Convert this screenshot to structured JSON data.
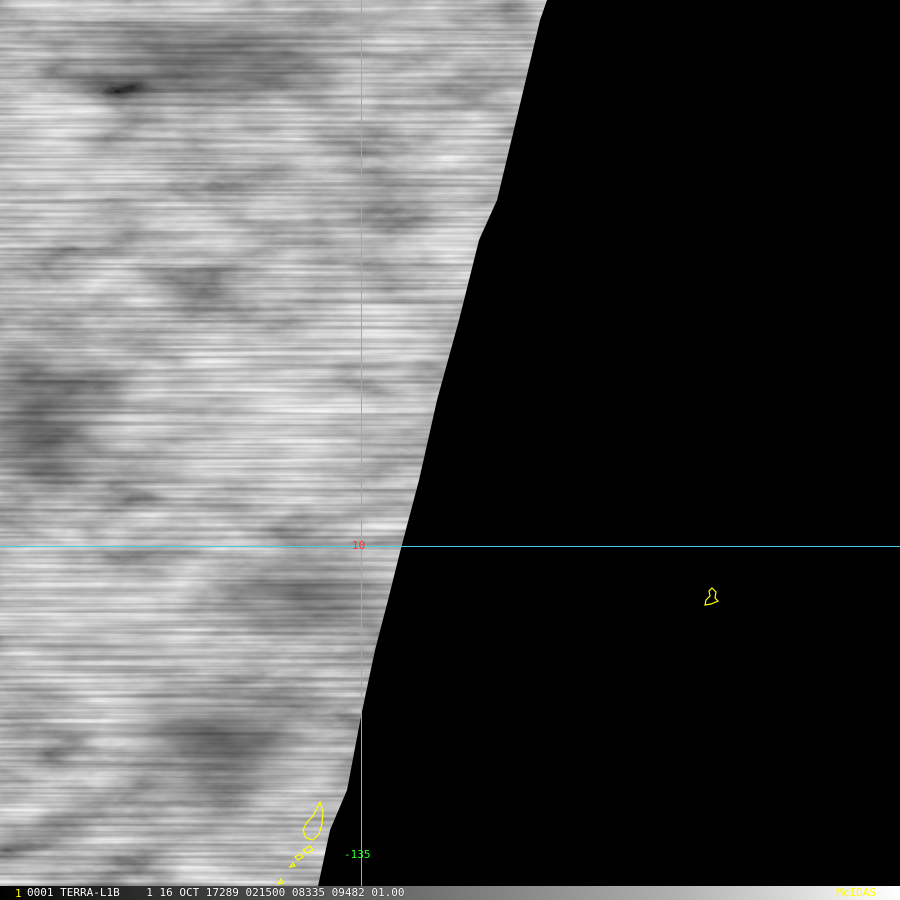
{
  "map": {
    "lat_label": "10",
    "lon_label": "-135",
    "colors": {
      "graticule": "#40d0e0",
      "coastline": "#ffff00",
      "lat_label": "#ff3030",
      "lon_label": "#30ff30",
      "no_data": "#000000"
    }
  },
  "status_bar": {
    "frame_number": "1",
    "info": "0001 TERRA-L1B    1 16 OCT 17289 021500 08335 09482 01.00",
    "brand": "McIDAS"
  }
}
